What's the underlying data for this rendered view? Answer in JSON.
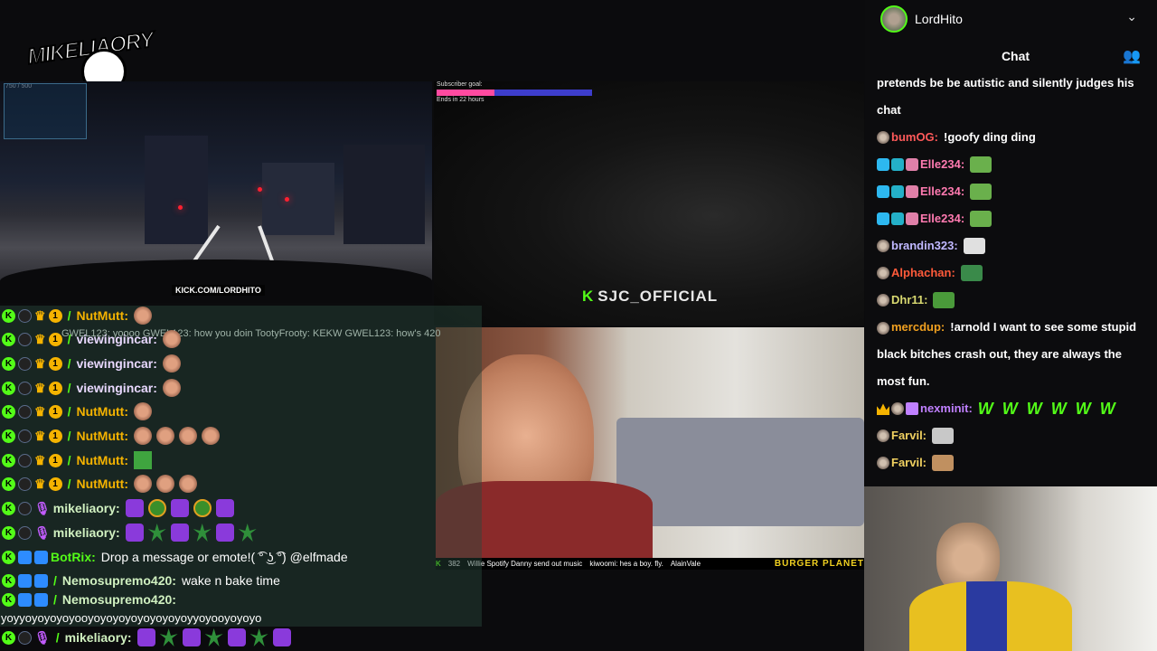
{
  "logo": {
    "text": "MIKELIAORY"
  },
  "feeds": {
    "drive": {
      "counter": "750 / 500",
      "kick_url": "KICK.COM/LORDHITO"
    },
    "sjc": {
      "sub_goal_label": "Subscriber goal:",
      "sub_goal_ends": "Ends in 22 hours",
      "sub_goal_progress": 0.37,
      "streamer_tag": "SJC_OFFICIAL"
    },
    "room": {},
    "cam": {}
  },
  "overlay_chat": {
    "ghost_text": "GWEL123: yoooo GWEL123: how you doin TootyFrooty: KEKW GWEL123: how's 420?",
    "rows": [
      {
        "username": "NutMutt:",
        "color": "#f5b300",
        "emotes": [
          "face"
        ]
      },
      {
        "username": "viewingincar:",
        "color": "#e8d8ff",
        "emotes": [
          "face"
        ]
      },
      {
        "username": "viewingincar:",
        "color": "#e8d8ff",
        "emotes": [
          "face"
        ]
      },
      {
        "username": "viewingincar:",
        "color": "#e8d8ff",
        "emotes": [
          "face"
        ]
      },
      {
        "username": "NutMutt:",
        "color": "#f5b300",
        "emotes": [
          "face"
        ]
      },
      {
        "username": "NutMutt:",
        "color": "#f5b300",
        "emotes": [
          "face",
          "face",
          "face",
          "face"
        ]
      },
      {
        "username": "NutMutt:",
        "color": "#f5b300",
        "emotes": [
          "creeper"
        ]
      },
      {
        "username": "NutMutt:",
        "color": "#f5b300",
        "emotes": [
          "face",
          "face",
          "face"
        ]
      },
      {
        "username": "mikeliaory:",
        "color": "#d0f0c0",
        "emotes": [
          "purple",
          "round",
          "purple",
          "round",
          "purple"
        ]
      },
      {
        "username": "mikeliaory:",
        "color": "#d0f0c0",
        "emotes": [
          "purple",
          "weed",
          "purple",
          "weed",
          "purple",
          "weed"
        ]
      },
      {
        "username": "BotRix:",
        "color": "#53fc18",
        "message": "Drop a message or emote!",
        "tail": "( ͡° ͜ʖ ͡°) @elfmade"
      },
      {
        "username": "Nemosupremo420:",
        "color": "#d0f0c0",
        "message": "wake n bake time"
      },
      {
        "username": "Nemosupremo420:",
        "color": "#d0f0c0",
        "message": ""
      },
      {
        "username": "mikeliaory:",
        "color": "#d0f0c0",
        "emotes": [
          "purple",
          "weed",
          "purple",
          "weed",
          "purple",
          "weed",
          "purple"
        ]
      }
    ],
    "wrapped_text": "yoyyoyoyoyoyooyoyoyoyoyoyoyoyoyyoyooyoyoyo"
  },
  "ticker": {
    "items": [
      "382",
      "Willie Spotify Danny send out music",
      "kiwoomi: hes a boy. fly.",
      "AlainVale"
    ],
    "brand": "BURGER PLANET"
  },
  "right_panel": {
    "channel_name": "LordHito",
    "chat_title": "Chat",
    "messages": [
      {
        "text": "pretends be be autistic and silently judges his chat"
      },
      {
        "username": "bumOG:",
        "color": "#ff5a5a",
        "text": "!goofy ding ding"
      },
      {
        "username": "Elle234:",
        "color": "#ff7ab0",
        "emote": "bat"
      },
      {
        "username": "Elle234:",
        "color": "#ff7ab0",
        "emote": "bat"
      },
      {
        "username": "Elle234:",
        "color": "#ff7ab0",
        "emote": "bat"
      },
      {
        "username": "brandin323:",
        "color": "#c0b8ff",
        "emote": "W"
      },
      {
        "username": "Alphachan:",
        "color": "#ff5a3a",
        "emote": "face"
      },
      {
        "username": "Dhr11:",
        "color": "#d8d870",
        "emote": "frog"
      },
      {
        "username": "mercdup:",
        "color": "#f0a020",
        "text": "!arnold I want to see some stupid black bitches crash out, they are always the most fun."
      },
      {
        "username": "nexminit:",
        "color": "#c080ff",
        "w_count": 6,
        "w_char": "W"
      },
      {
        "username": "Farvil:",
        "color": "#f0d060",
        "emote": "car"
      },
      {
        "username": "Farvil:",
        "color": "#f0d060",
        "emote": "dog"
      }
    ]
  },
  "colors": {
    "kick_green": "#53fc18",
    "panel_bg": "#0c0c0e",
    "overlay_bg": "rgba(40,70,60,0.45)"
  }
}
